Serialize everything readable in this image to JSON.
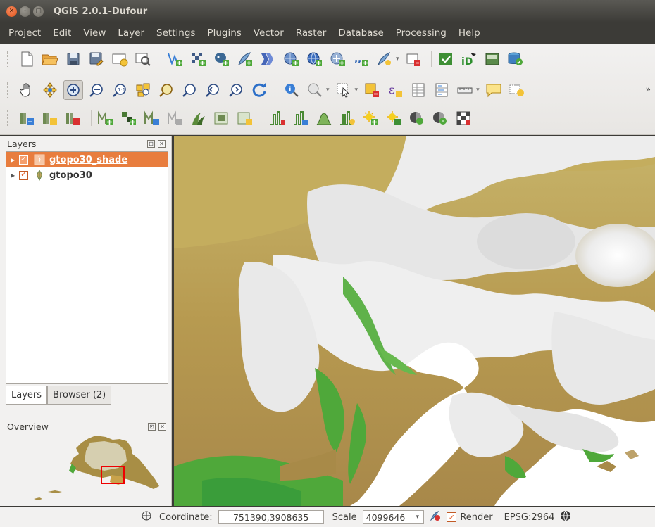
{
  "window": {
    "title": "QGIS 2.0.1-Dufour",
    "buttons": [
      "close",
      "minimize",
      "maximize"
    ]
  },
  "menubar": {
    "items": [
      "Project",
      "Edit",
      "View",
      "Layer",
      "Settings",
      "Plugins",
      "Vector",
      "Raster",
      "Database",
      "Processing",
      "Help"
    ]
  },
  "toolbars": {
    "row1": [
      "new-project",
      "open-project",
      "save-project",
      "save-as",
      "new-print-composer",
      "composer-manager",
      "digitize-vertex",
      "add-raster",
      "add-postgis",
      "add-spatialite",
      "add-wms",
      "add-wcs",
      "add-wfs",
      "add-mssql",
      "add-delimited-text",
      "new-shapefile",
      "green-plugin",
      "oracle",
      "db-manager"
    ],
    "row2": [
      "pan",
      "pan-to-selection",
      "zoom-in",
      "zoom-out",
      "zoom-actual",
      "zoom-full",
      "zoom-layer",
      "zoom-selection",
      "zoom-last",
      "zoom-next",
      "refresh",
      "identify",
      "feature-action",
      "select",
      "deselect",
      "field-calculator",
      "attribute-table",
      "statistics",
      "measure",
      "annotation",
      "new-bookmark"
    ],
    "row3": [
      "raster-calc",
      "raster-georef",
      "raster-clip",
      "vector-info",
      "vector-add",
      "vector-edit",
      "vector-delete",
      "grass",
      "raster-merge",
      "raster-warp",
      "heatmap",
      "terrain",
      "roadgraph",
      "interpolation",
      "sun-new",
      "sun-add",
      "roadgraph-a",
      "roadgraph-b",
      "checkerboard"
    ]
  },
  "layers_dock": {
    "title": "Layers",
    "layers": [
      {
        "name": "gtopo30_shade",
        "checked": true,
        "selected": true
      },
      {
        "name": "gtopo30",
        "checked": true,
        "selected": false
      }
    ],
    "tabs": [
      "Layers",
      "Browser (2)"
    ]
  },
  "overview_dock": {
    "title": "Overview"
  },
  "statusbar": {
    "coordinate_label": "Coordinate:",
    "coordinate_value": "751390,3908635",
    "scale_label": "Scale",
    "scale_value": "4099646",
    "render_label": "Render",
    "render_checked": true,
    "crs": "EPSG:2964"
  },
  "colors": {
    "accent": "#e87d3e",
    "titlebar": "#3c3b37",
    "toolbar": "#f2f1f0",
    "terrain_low": "#3a9d3a",
    "terrain_mid": "#b0a046",
    "terrain_high": "#c08a34",
    "snow": "#f4f4f4"
  }
}
